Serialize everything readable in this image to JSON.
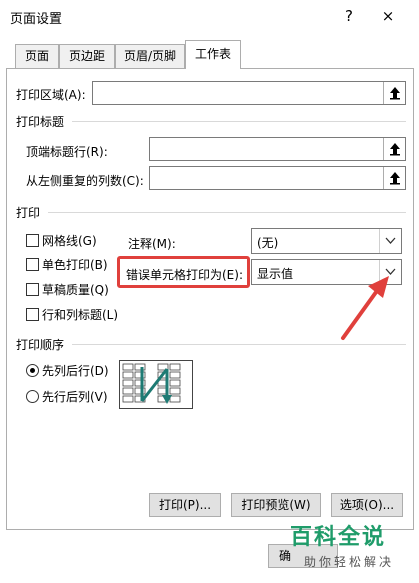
{
  "window": {
    "title": "页面设置",
    "help": "?",
    "close": "×"
  },
  "tabs": [
    {
      "label": "页面"
    },
    {
      "label": "页边距"
    },
    {
      "label": "页眉/页脚"
    },
    {
      "label": "工作表"
    }
  ],
  "print_area": {
    "label": "打印区域(A):",
    "value": ""
  },
  "print_titles": {
    "heading": "打印标题",
    "rows_label": "顶端标题行(R):",
    "rows_value": "",
    "cols_label": "从左侧重复的列数(C):",
    "cols_value": ""
  },
  "print": {
    "heading": "打印",
    "checkboxes": [
      {
        "label": "网格线(G)",
        "checked": false
      },
      {
        "label": "单色打印(B)",
        "checked": false
      },
      {
        "label": "草稿质量(Q)",
        "checked": false
      },
      {
        "label": "行和列标题(L)",
        "checked": false
      }
    ],
    "comments_label": "注释(M):",
    "comments_value": "(无)",
    "errors_label": "错误单元格打印为(E):",
    "errors_value": "显示值"
  },
  "page_order": {
    "heading": "打印顺序",
    "options": [
      {
        "label": "先列后行(D)",
        "selected": true
      },
      {
        "label": "先行后列(V)",
        "selected": false
      }
    ]
  },
  "buttons": {
    "print": "打印(P)...",
    "preview": "打印预览(W)",
    "options": "选项(O)...",
    "ok": "确"
  },
  "watermark": {
    "main": "百科全说",
    "sub": "助你轻松解决"
  },
  "colors": {
    "highlight": "#e0403c",
    "arrow": "#e0403c",
    "watermark": "#1f9c6a",
    "order_arrow": "#1e7b74"
  }
}
